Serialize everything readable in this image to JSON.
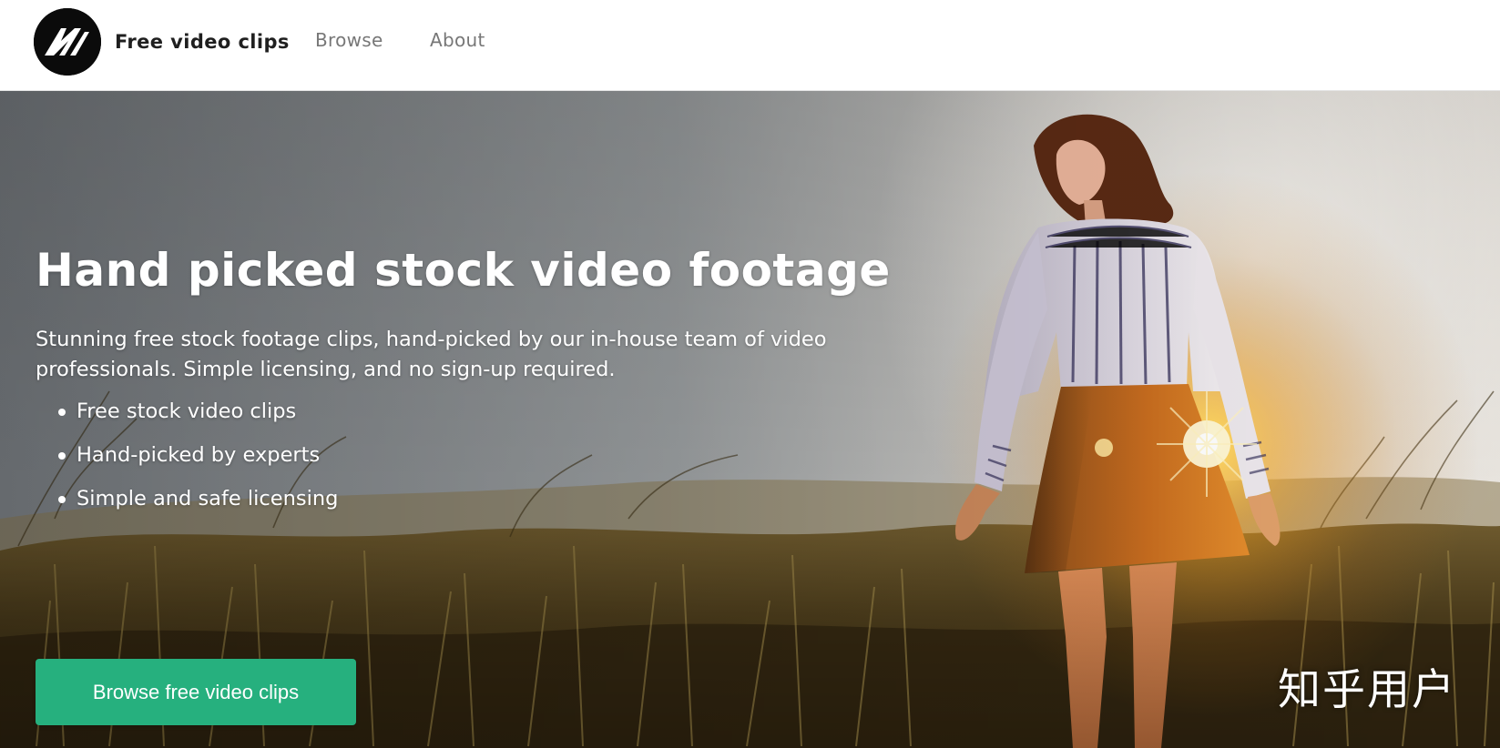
{
  "header": {
    "logo_icon": "mixkit-logo-icon",
    "brand_name": "Free video clips",
    "nav": {
      "browse_label": "Browse",
      "about_label": "About"
    }
  },
  "hero": {
    "title": "Hand picked stock video footage",
    "lead": "Stunning free stock footage clips, hand-picked by our in-house team of video professionals. Simple licensing, and no sign-up required.",
    "features": [
      "Free stock video clips",
      "Hand-picked by experts",
      "Simple and safe licensing"
    ],
    "cta_label": "Browse free video clips",
    "background_image": "woman-walking-in-field-at-sunset",
    "watermark": "知乎用户"
  },
  "colors": {
    "accent": "#26b07e",
    "header_bg": "#ffffff",
    "nav_text": "#777777",
    "brand_text": "#1f1f1f"
  }
}
